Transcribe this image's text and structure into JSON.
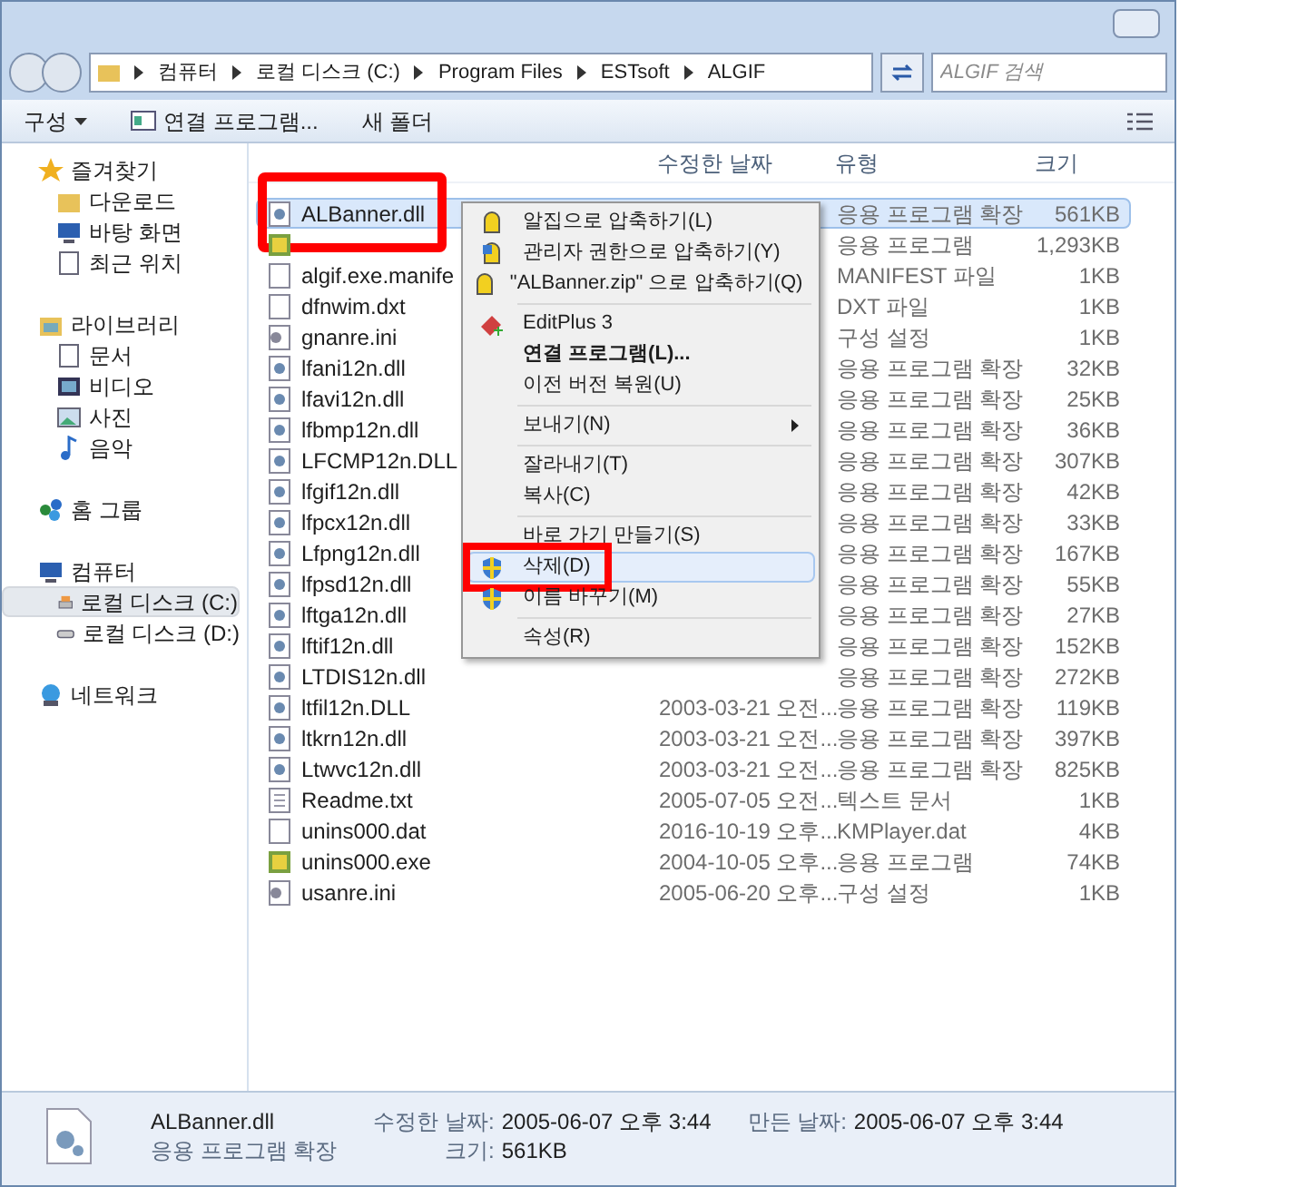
{
  "address": {
    "crumbs": [
      "컴퓨터",
      "로컬 디스크 (C:)",
      "Program Files",
      "ESTsoft",
      "ALGIF"
    ]
  },
  "search": {
    "placeholder": "ALGIF 검색"
  },
  "toolbar": [
    "구성",
    "연결 프로그램...",
    "새 폴더"
  ],
  "nav": [
    {
      "label": "즐겨찾기",
      "children": [
        {
          "label": "다운로드",
          "selected": false
        },
        {
          "label": "바탕 화면",
          "selected": false
        },
        {
          "label": "최근 위치",
          "selected": false
        }
      ]
    },
    {
      "label": "라이브러리",
      "children": [
        {
          "label": "문서",
          "selected": false
        },
        {
          "label": "비디오",
          "selected": false
        },
        {
          "label": "사진",
          "selected": false
        },
        {
          "label": "음악",
          "selected": false
        }
      ]
    },
    {
      "label": "홈 그룹"
    },
    {
      "label": "컴퓨터",
      "children": [
        {
          "label": "로컬 디스크 (C:)",
          "selected": true
        },
        {
          "label": "로컬 디스크 (D:)",
          "selected": false
        }
      ]
    },
    {
      "label": "네트워크"
    }
  ],
  "columns": [
    "수정한 날짜",
    "유형",
    "크기"
  ],
  "files": [
    {
      "name": "ALBanner.dll",
      "kind": "dll",
      "type": "응용 프로그램 확장",
      "size": "561KB",
      "selected": true,
      "highlighted": true
    },
    {
      "kind": "exe",
      "type": "응용 프로그램",
      "size": "1,293KB",
      "selected": false,
      "highlighted": false
    },
    {
      "name": "algif.exe.manife",
      "kind": "file",
      "type": "MANIFEST 파일",
      "size": "1KB",
      "selected": false,
      "highlighted": false
    },
    {
      "name": "dfnwim.dxt",
      "kind": "file",
      "type": "DXT 파일",
      "size": "1KB",
      "selected": false,
      "highlighted": false
    },
    {
      "name": "gnanre.ini",
      "kind": "ini",
      "type": "구성 설정",
      "size": "1KB",
      "selected": false,
      "highlighted": false
    },
    {
      "name": "lfani12n.dll",
      "kind": "dll",
      "type": "응용 프로그램 확장",
      "size": "32KB",
      "selected": false,
      "highlighted": false
    },
    {
      "name": "lfavi12n.dll",
      "kind": "dll",
      "type": "응용 프로그램 확장",
      "size": "25KB",
      "selected": false,
      "highlighted": false
    },
    {
      "name": "lfbmp12n.dll",
      "kind": "dll",
      "type": "응용 프로그램 확장",
      "size": "36KB",
      "selected": false,
      "highlighted": false
    },
    {
      "name": "LFCMP12n.DLL",
      "kind": "dll",
      "type": "응용 프로그램 확장",
      "size": "307KB",
      "selected": false,
      "highlighted": false
    },
    {
      "name": "lfgif12n.dll",
      "kind": "dll",
      "type": "응용 프로그램 확장",
      "size": "42KB",
      "selected": false,
      "highlighted": false
    },
    {
      "name": "lfpcx12n.dll",
      "kind": "dll",
      "type": "응용 프로그램 확장",
      "size": "33KB",
      "selected": false,
      "highlighted": false
    },
    {
      "name": "Lfpng12n.dll",
      "kind": "dll",
      "type": "응용 프로그램 확장",
      "size": "167KB",
      "selected": false,
      "highlighted": false
    },
    {
      "name": "lfpsd12n.dll",
      "kind": "dll",
      "type": "응용 프로그램 확장",
      "size": "55KB",
      "selected": false,
      "highlighted": false
    },
    {
      "name": "lftga12n.dll",
      "kind": "dll",
      "type": "응용 프로그램 확장",
      "size": "27KB",
      "selected": false,
      "highlighted": false
    },
    {
      "name": "lftif12n.dll",
      "kind": "dll",
      "type": "응용 프로그램 확장",
      "size": "152KB",
      "selected": false,
      "highlighted": false
    },
    {
      "name": "LTDIS12n.dll",
      "kind": "dll",
      "type": "응용 프로그램 확장",
      "size": "272KB",
      "selected": false,
      "highlighted": false
    },
    {
      "name": "ltfil12n.DLL",
      "kind": "dll",
      "date": "2003-03-21 오전...",
      "type": "응용 프로그램 확장",
      "size": "119KB",
      "selected": false,
      "highlighted": false
    },
    {
      "name": "ltkrn12n.dll",
      "kind": "dll",
      "date": "2003-03-21 오전...",
      "type": "응용 프로그램 확장",
      "size": "397KB",
      "selected": false,
      "highlighted": false
    },
    {
      "name": "Ltwvc12n.dll",
      "kind": "dll",
      "date": "2003-03-21 오전...",
      "type": "응용 프로그램 확장",
      "size": "825KB",
      "selected": false,
      "highlighted": false
    },
    {
      "name": "Readme.txt",
      "kind": "txt",
      "date": "2005-07-05 오전...",
      "type": "텍스트 문서",
      "size": "1KB",
      "selected": false,
      "highlighted": false
    },
    {
      "name": "unins000.dat",
      "kind": "file",
      "date": "2016-10-19 오후...",
      "type": "KMPlayer.dat",
      "size": "4KB",
      "selected": false,
      "highlighted": false
    },
    {
      "name": "unins000.exe",
      "kind": "exe",
      "date": "2004-10-05 오후...",
      "type": "응용 프로그램",
      "size": "74KB",
      "selected": false,
      "highlighted": false
    },
    {
      "name": "usanre.ini",
      "kind": "ini",
      "date": "2005-06-20 오후...",
      "type": "구성 설정",
      "size": "1KB",
      "selected": false,
      "highlighted": false
    }
  ],
  "context_menu": [
    {
      "kind": "item",
      "label": "알집으로 압축하기(L)",
      "default": false,
      "submenu": false,
      "selected": false,
      "highlighted": false
    },
    {
      "kind": "item",
      "label": "관리자 권한으로 압축하기(Y)",
      "default": false,
      "submenu": false,
      "selected": false,
      "highlighted": false
    },
    {
      "kind": "item",
      "label": "\"ALBanner.zip\" 으로 압축하기(Q)",
      "default": false,
      "submenu": false,
      "selected": false,
      "highlighted": false
    },
    {
      "kind": "separator"
    },
    {
      "kind": "item",
      "label": "EditPlus 3",
      "default": false,
      "submenu": false,
      "selected": false,
      "highlighted": false
    },
    {
      "kind": "item",
      "label": "연결 프로그램(L)...",
      "default": true,
      "submenu": false,
      "selected": false,
      "highlighted": false
    },
    {
      "kind": "item",
      "label": "이전 버전 복원(U)",
      "default": false,
      "submenu": false,
      "selected": false,
      "highlighted": false
    },
    {
      "kind": "separator"
    },
    {
      "kind": "item",
      "label": "보내기(N)",
      "default": false,
      "submenu": true,
      "selected": false,
      "highlighted": false
    },
    {
      "kind": "separator"
    },
    {
      "kind": "item",
      "label": "잘라내기(T)",
      "default": false,
      "submenu": false,
      "selected": false,
      "highlighted": false
    },
    {
      "kind": "item",
      "label": "복사(C)",
      "default": false,
      "submenu": false,
      "selected": false,
      "highlighted": false
    },
    {
      "kind": "separator"
    },
    {
      "kind": "item",
      "label": "바로 가기 만들기(S)",
      "default": false,
      "submenu": false,
      "selected": false,
      "highlighted": false
    },
    {
      "kind": "item",
      "label": "삭제(D)",
      "default": false,
      "submenu": false,
      "selected": true,
      "highlighted": true
    },
    {
      "kind": "item",
      "label": "이름 바꾸기(M)",
      "default": false,
      "submenu": false,
      "selected": false,
      "highlighted": false
    },
    {
      "kind": "separator"
    },
    {
      "kind": "item",
      "label": "속성(R)",
      "default": false,
      "submenu": false,
      "selected": false,
      "highlighted": false
    }
  ],
  "details": {
    "name": "ALBanner.dll",
    "type": "응용 프로그램 확장",
    "fields": [
      {
        "label": "수정한 날짜:",
        "value": "2005-06-07 오후 3:44"
      },
      {
        "label": "만든 날짜:",
        "value": "2005-06-07 오후 3:44"
      },
      {
        "label": "크기:",
        "value": "561KB"
      }
    ]
  }
}
